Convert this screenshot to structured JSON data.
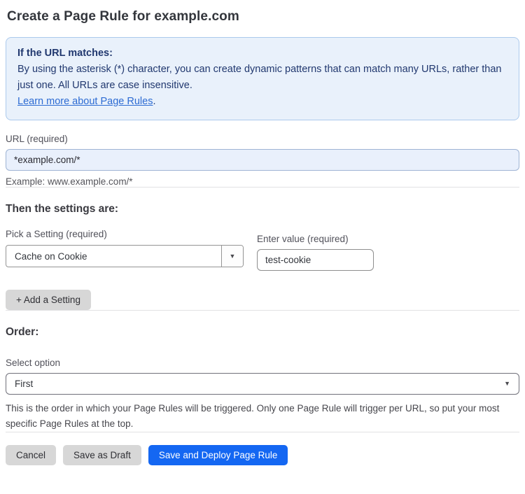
{
  "page": {
    "title": "Create a Page Rule for example.com"
  },
  "info_box": {
    "heading": "If the URL matches:",
    "body": "By using the asterisk (*) character, you can create dynamic patterns that can match many URLs, rather than just one. All URLs are case insensitive.",
    "link_label": "Learn more about Page Rules",
    "link_suffix": "."
  },
  "url_field": {
    "label": "URL (required)",
    "value": "*example.com/*",
    "example": "Example: www.example.com/*"
  },
  "settings_section": {
    "heading": "Then the settings are:",
    "setting_label": "Pick a Setting (required)",
    "setting_value": "Cache on Cookie",
    "value_label": "Enter value (required)",
    "value_value": "test-cookie",
    "add_setting_label": "+ Add a Setting",
    "dropdown_caret": "▼"
  },
  "order_section": {
    "heading": "Order:",
    "select_label": "Select option",
    "select_value": "First",
    "select_caret": "▼",
    "helper": "This is the order in which your Page Rules will be triggered. Only one Page Rule will trigger per URL, so put your most specific Page Rules at the top."
  },
  "actions": {
    "cancel": "Cancel",
    "save_draft": "Save as Draft",
    "save_deploy": "Save and Deploy Page Rule"
  },
  "colors": {
    "accent_blue": "#1467f2",
    "info_bg": "#e9f1fb",
    "info_border": "#abc9ec",
    "info_text": "#21386f",
    "link_blue": "#2c6bd3",
    "url_input_bg": "#e9f0fc",
    "button_gray": "#d7d7d7"
  }
}
